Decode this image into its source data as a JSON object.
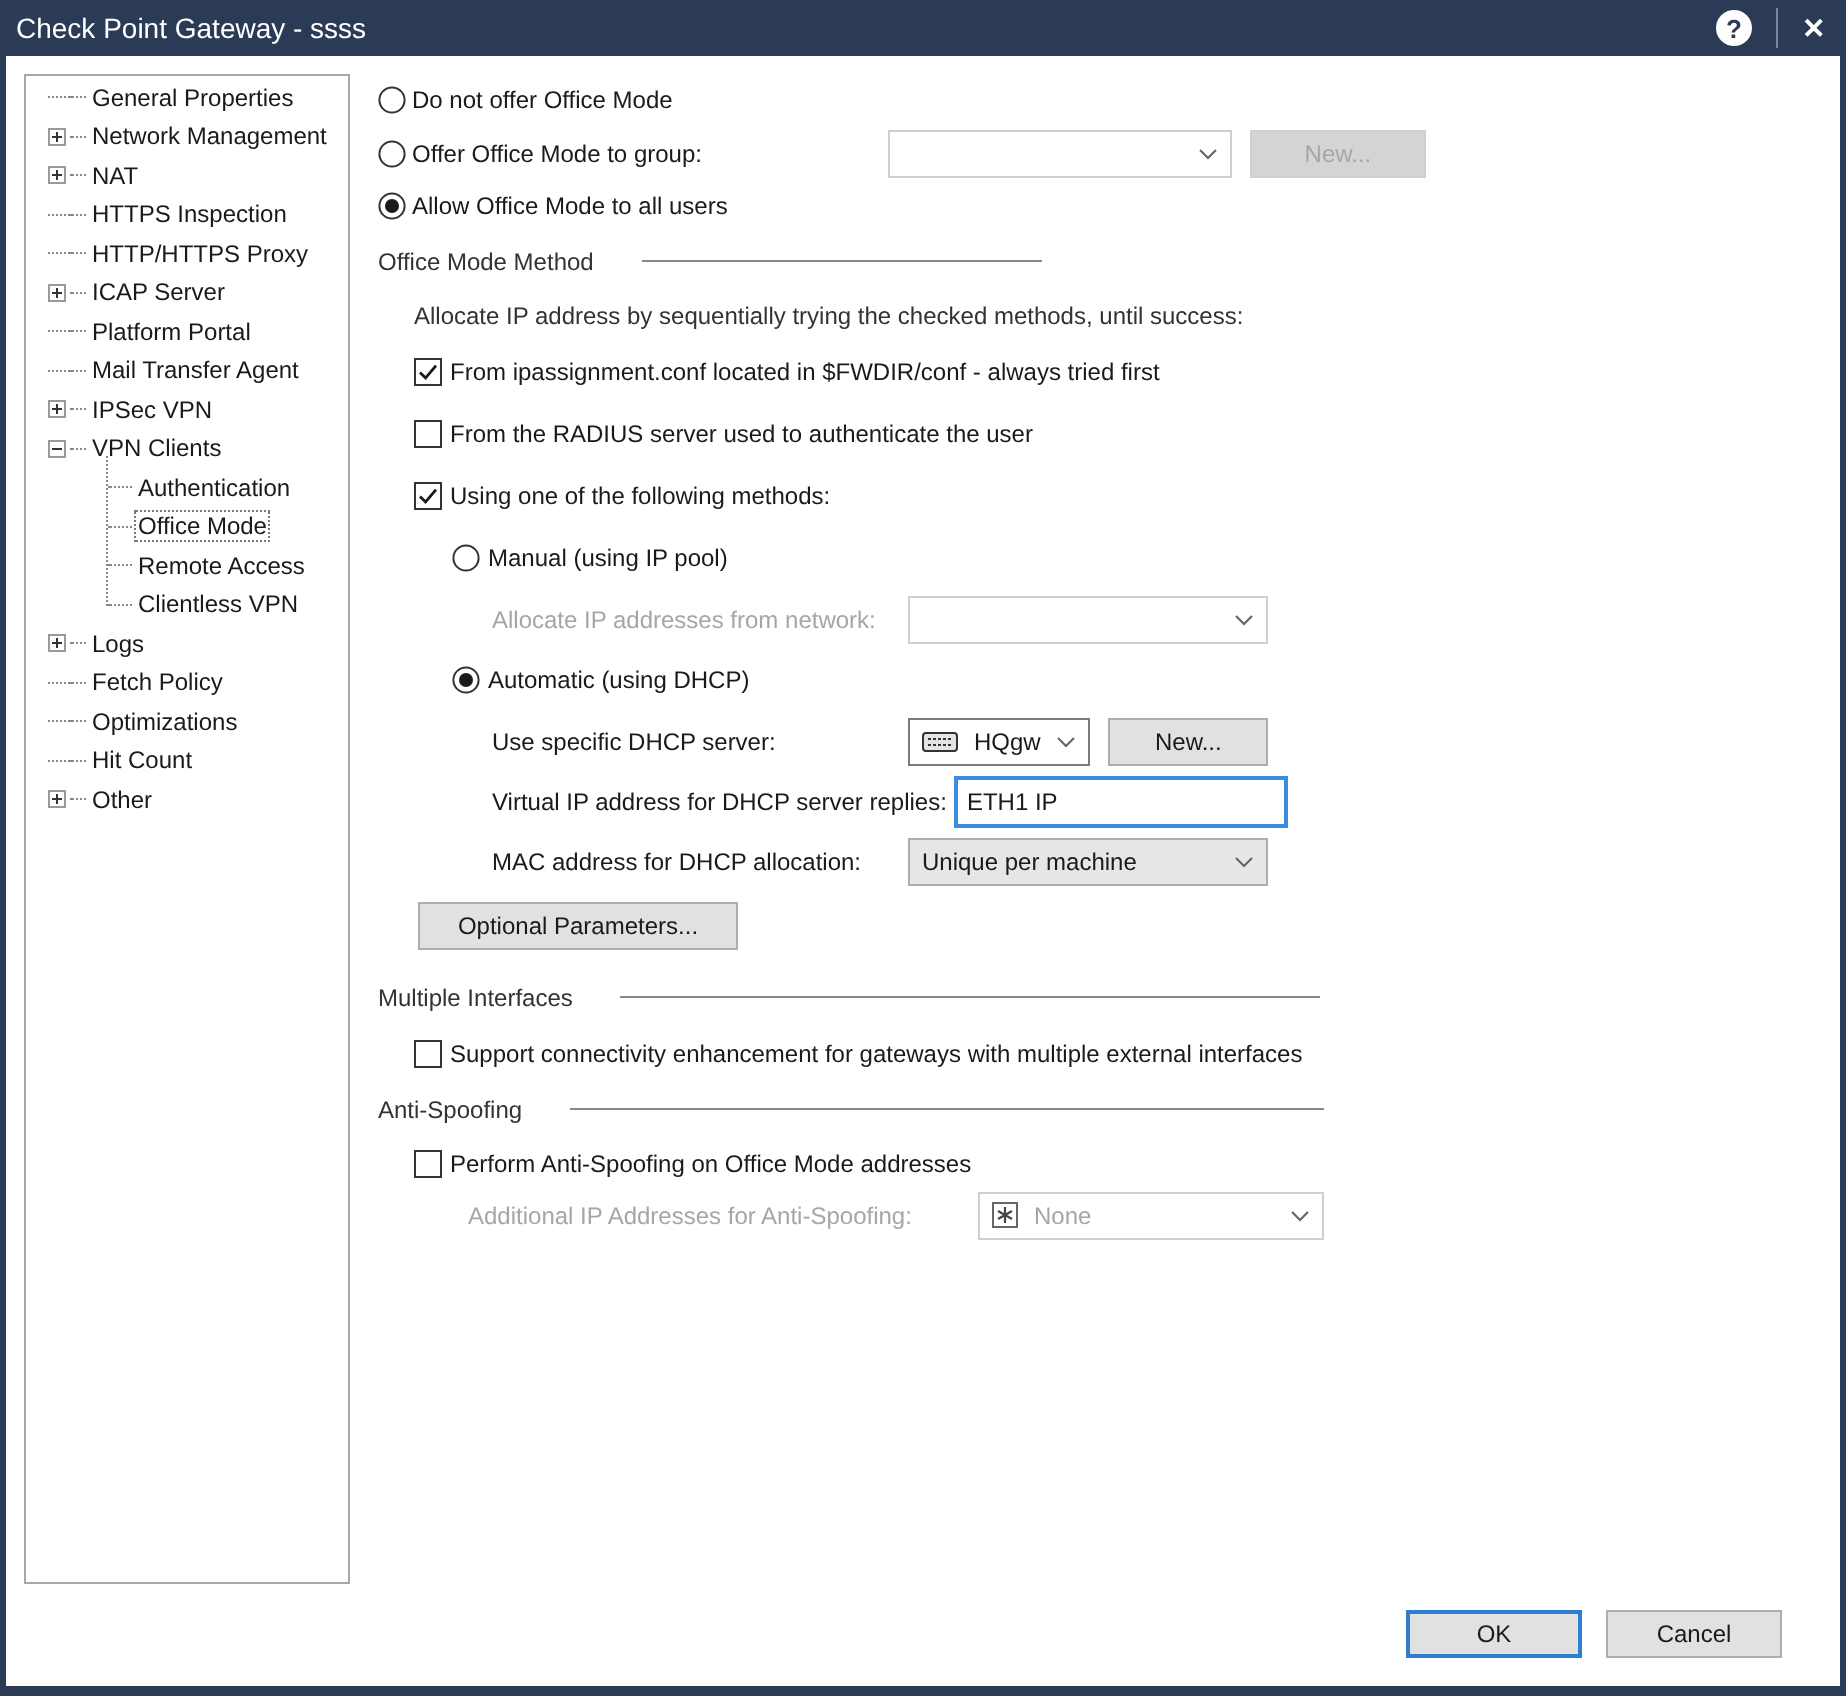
{
  "window": {
    "title": "Check Point Gateway - ssss",
    "help": "?",
    "close": "✕"
  },
  "sidebar": {
    "items": [
      {
        "label": "General Properties",
        "selected": false
      },
      {
        "label": "Network Management",
        "selected": false,
        "expanded": false
      },
      {
        "label": "NAT",
        "selected": false,
        "expanded": false
      },
      {
        "label": "HTTPS Inspection",
        "selected": false
      },
      {
        "label": "HTTP/HTTPS Proxy",
        "selected": false
      },
      {
        "label": "ICAP Server",
        "selected": false,
        "expanded": false
      },
      {
        "label": "Platform Portal",
        "selected": false
      },
      {
        "label": "Mail Transfer Agent",
        "selected": false
      },
      {
        "label": "IPSec VPN",
        "selected": false,
        "expanded": false
      },
      {
        "label": "VPN Clients",
        "selected": false,
        "expanded": true,
        "children": [
          {
            "label": "Authentication",
            "selected": false
          },
          {
            "label": "Office Mode",
            "selected": true
          },
          {
            "label": "Remote Access",
            "selected": false
          },
          {
            "label": "Clientless VPN",
            "selected": false
          }
        ]
      },
      {
        "label": "Logs",
        "selected": false,
        "expanded": false
      },
      {
        "label": "Fetch Policy",
        "selected": false
      },
      {
        "label": "Optimizations",
        "selected": false
      },
      {
        "label": "Hit Count",
        "selected": false
      },
      {
        "label": "Other",
        "selected": false,
        "expanded": false
      }
    ]
  },
  "office_mode_options": [
    {
      "label": "Do not offer Office Mode",
      "selected": false
    },
    {
      "label": "Offer Office Mode to group:",
      "selected": false,
      "dropdown": {
        "disabled": true
      },
      "button": {
        "label": "New...",
        "disabled": true
      }
    },
    {
      "label": "Allow Office Mode to all users",
      "selected": true
    }
  ],
  "office_mode_method": {
    "title": "Office Mode Method",
    "description": "Allocate IP address by sequentially trying the checked methods, until success:",
    "methods": [
      {
        "label": "From ipassignment.conf located in $FWDIR/conf - always tried first",
        "checked": true
      },
      {
        "label": "From the RADIUS server used to authenticate the user",
        "checked": false
      },
      {
        "label": "Using one of the following methods:",
        "checked": true
      }
    ],
    "sub_options": [
      {
        "label": "Manual (using IP pool)",
        "selected": false,
        "fields": [
          {
            "kind": "dropdown",
            "label": "Allocate IP addresses from network:",
            "disabled": true
          }
        ]
      },
      {
        "label": "Automatic (using DHCP)",
        "selected": true,
        "fields": [
          {
            "kind": "object_dropdown",
            "label": "Use specific DHCP server:",
            "value": "HQgw",
            "button": {
              "label": "New...",
              "disabled": false
            }
          },
          {
            "kind": "text",
            "label": "Virtual IP address for DHCP server replies:",
            "value": "ETH1 IP",
            "focused": true
          },
          {
            "kind": "select",
            "label": "MAC address for DHCP allocation:",
            "value": "Unique per machine"
          }
        ]
      }
    ],
    "optional_button": "Optional Parameters..."
  },
  "multiple_interfaces": {
    "title": "Multiple Interfaces",
    "options": [
      {
        "label": "Support connectivity enhancement for gateways with multiple external interfaces",
        "checked": false
      }
    ]
  },
  "anti_spoofing": {
    "title": "Anti-Spoofing",
    "options": [
      {
        "label": "Perform Anti-Spoofing on Office Mode addresses",
        "checked": false
      }
    ],
    "field": {
      "kind": "list_dropdown",
      "label": "Additional IP Addresses for Anti-Spoofing:",
      "value": "None",
      "disabled": true
    }
  },
  "buttons": [
    {
      "label": "OK",
      "default": true
    },
    {
      "label": "Cancel",
      "default": false
    }
  ]
}
